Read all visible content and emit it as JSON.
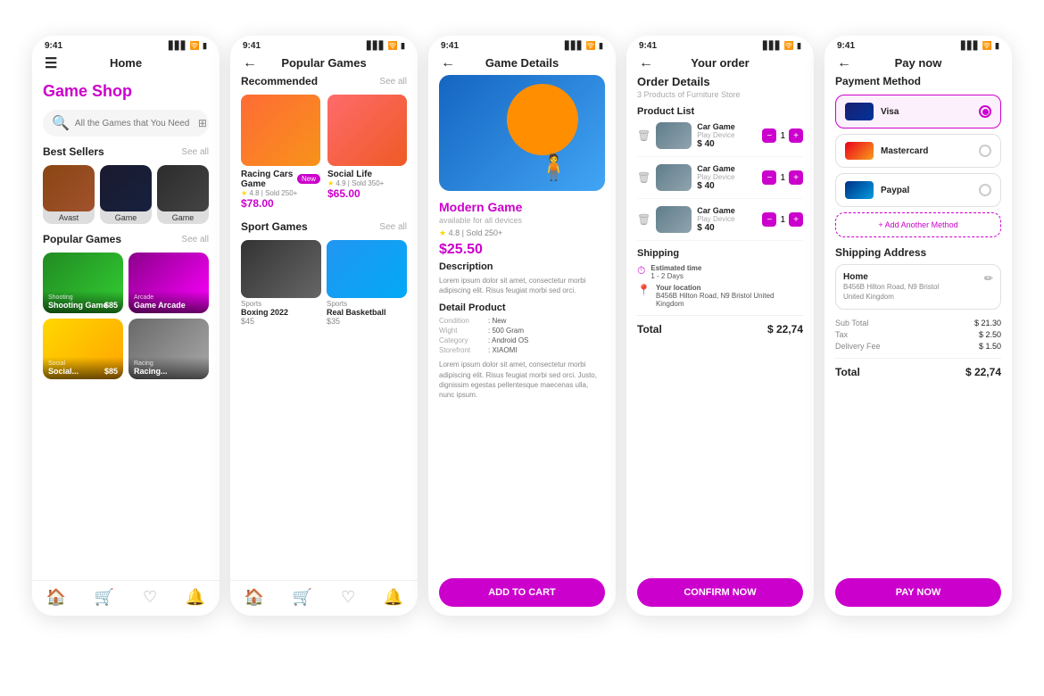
{
  "screens": [
    {
      "id": "screen1",
      "statusTime": "9:41",
      "navTitle": "Home",
      "appTitle": "Game Shop",
      "searchPlaceholder": "All the Games that You Need",
      "bestSellers": {
        "title": "Best Sellers",
        "seeAll": "See all",
        "items": [
          {
            "label": "Avast",
            "colorClass": "img-avast"
          },
          {
            "label": "Game",
            "colorClass": "img-game1"
          },
          {
            "label": "Game",
            "colorClass": "img-game2"
          }
        ]
      },
      "popularGames": {
        "title": "Popular Games",
        "seeAll": "See all",
        "items": [
          {
            "category": "Shooting",
            "name": "Shooting Game",
            "price": "$85",
            "colorClass": "img-shooting"
          },
          {
            "category": "Arcade",
            "name": "Game Arcade",
            "price": "",
            "colorClass": "img-arcade"
          },
          {
            "category": "Social",
            "name": "Social...",
            "price": "$85",
            "colorClass": "img-social"
          },
          {
            "category": "Racing",
            "name": "Racing...",
            "price": "",
            "colorClass": "img-racing"
          }
        ]
      },
      "bottomNav": [
        "home",
        "cart",
        "heart",
        "bell"
      ]
    },
    {
      "id": "screen2",
      "statusTime": "9:41",
      "navTitle": "Popular Games",
      "recommended": {
        "title": "Recommended",
        "seeAll": "See all",
        "items": [
          {
            "name": "Racing Cars Game",
            "badge": "New",
            "rating": "4.8",
            "sold": "Sold 250+",
            "price": "$78.00",
            "colorClass": "rec-img-car"
          },
          {
            "name": "Social Life",
            "badge": null,
            "rating": "4.9",
            "sold": "Sold 350+",
            "price": "$65.00",
            "colorClass": "rec-img-social"
          }
        ]
      },
      "sportGames": {
        "title": "Sport Games",
        "seeAll": "See all",
        "items": [
          {
            "category": "Sports",
            "name": "Boxing 2022",
            "price": "$45",
            "colorClass": "sport-img-boxing"
          },
          {
            "category": "Sports",
            "name": "Real Basketball",
            "price": "$35",
            "colorClass": "sport-img-basket"
          }
        ]
      },
      "bottomNav": [
        "home",
        "cart",
        "heart",
        "bell"
      ]
    },
    {
      "id": "screen3",
      "statusTime": "9:41",
      "navTitle": "Game  Details",
      "game": {
        "name": "Modern Game",
        "availability": "available for all devices",
        "rating": "4.8",
        "sold": "Sold 250+",
        "price": "$25.50",
        "descTitle": "Description",
        "desc": "Lorem ipsum dolor sit amet, consectetur morbi adipiscing elit. Risus feugiat morbi sed orci.",
        "detailTitle": "Detail Product",
        "details": [
          {
            "key": "Condition",
            "val": "New"
          },
          {
            "key": "Wight",
            "val": "500 Gram"
          },
          {
            "key": "Category",
            "val": "Android OS"
          },
          {
            "key": "Storefront",
            "val": "XIAOMI"
          }
        ],
        "extraDesc": "Lorem ipsum dolor sit amet, consectetur morbi adipiscing elit. Risus feugiat morbi sed orci. Justo, dignissim egestas pellentesque maecenas ulla, nunc ipsum.",
        "addToCart": "ADD TO CART"
      }
    },
    {
      "id": "screen4",
      "statusTime": "9:41",
      "navTitle": "Your order",
      "orderTitle": "Order Details",
      "orderSubtitle": "3 Products of Furniture Store",
      "productListTitle": "Product List",
      "products": [
        {
          "name": "Car Game",
          "cat": "Play Device",
          "price": "$ 40",
          "qty": 1
        },
        {
          "name": "Car Game",
          "cat": "Play Device",
          "price": "$ 40",
          "qty": 1
        },
        {
          "name": "Car Game",
          "cat": "Play Device",
          "price": "$ 40",
          "qty": 1
        }
      ],
      "shippingTitle": "Shipping",
      "shipping": {
        "estimated": "Estimated time",
        "estimatedVal": "1 - 2 Days",
        "locationLabel": "Your location",
        "locationVal": "B456B Hilton Road, N9 Bristol United Kingdom"
      },
      "totalLabel": "Total",
      "totalAmount": "$ 22,74",
      "confirmBtn": "CONFIRM NOW"
    },
    {
      "id": "screen5",
      "statusTime": "9:41",
      "navTitle": "Pay now",
      "paymentMethodTitle": "Payment Method",
      "paymentMethods": [
        {
          "name": "Visa",
          "type": "visa",
          "active": true
        },
        {
          "name": "Mastercard",
          "type": "mc",
          "active": false
        },
        {
          "name": "Paypal",
          "type": "pp",
          "active": false
        }
      ],
      "addMethodLabel": "+ Add Another Method",
      "shippingAddressTitle": "Shipping Address",
      "address": {
        "label": "Home",
        "text": "B456B Hilton Road, N9 Bristol\nUnited Kingdom"
      },
      "summary": {
        "subTotalLabel": "Sub Total",
        "subTotalVal": "$ 21.30",
        "taxLabel": "Tax",
        "taxVal": "$ 2.50",
        "deliveryLabel": "Delivery Fee",
        "deliveryVal": "$ 1.50"
      },
      "totalLabel": "Total",
      "totalAmount": "$ 22,74",
      "payBtn": "PAY NOW"
    }
  ]
}
